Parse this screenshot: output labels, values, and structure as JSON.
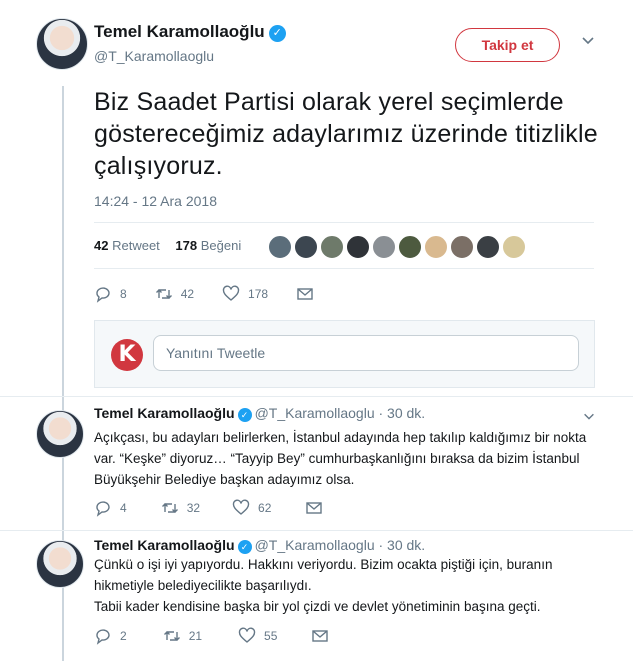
{
  "main_tweet": {
    "name": "Temel Karamollaoğlu",
    "handle": "@T_Karamollaoglu",
    "follow_label": "Takip et",
    "text": "Biz Saadet Partisi olarak yerel seçimlerde göstereceğimiz adaylarımız üzerinde titizlikle çalışıyoruz.",
    "timestamp": "14:24 - 12 Ara 2018",
    "retweet_count": "42",
    "retweet_label": "Retweet",
    "like_count": "178",
    "like_label": "Beğeni",
    "actions": {
      "replies": "8",
      "retweets": "42",
      "likes": "178"
    },
    "liker_colors": [
      "#5b6d7a",
      "#3c4650",
      "#6e7a6a",
      "#2f3338",
      "#8a8f94",
      "#4d5a3f",
      "#d9b98f",
      "#7b6f66",
      "#3a3f44",
      "#d7c89a"
    ]
  },
  "reply_box": {
    "logo_letter": "K",
    "placeholder": "Yanıtını Tweetle"
  },
  "replies": [
    {
      "name": "Temel Karamollaoğlu",
      "meta": "@T_Karamollaoglu · 30 dk.",
      "lines": [
        "Açıkçası, bu adayları belirlerken, İstanbul adayında hep takılıp kaldığımız bir nokta",
        "var. “Keşke” diyoruz… “Tayyip Bey” cumhurbaşkanlığını bıraksa da bizim İstanbul",
        "Büyükşehir Belediye başkan adayımız olsa."
      ],
      "actions": {
        "replies": "4",
        "retweets": "32",
        "likes": "62"
      }
    },
    {
      "name": "Temel Karamollaoğlu",
      "meta": "@T_Karamollaoglu · 30 dk.",
      "lines": [
        "Çünkü o işi iyi yapıyordu. Hakkını veriyordu. Bizim ocakta piştiği için, buranın",
        "hikmetiyle belediyecilikte başarılıydı.",
        "Tabii kader kendisine başka bir yol çizdi ve devlet yönetiminin başına geçti."
      ],
      "actions": {
        "replies": "2",
        "retweets": "21",
        "likes": "55"
      }
    }
  ],
  "colors": {
    "accent": "#d1373f",
    "verified": "#1da1f2",
    "muted": "#657786"
  }
}
